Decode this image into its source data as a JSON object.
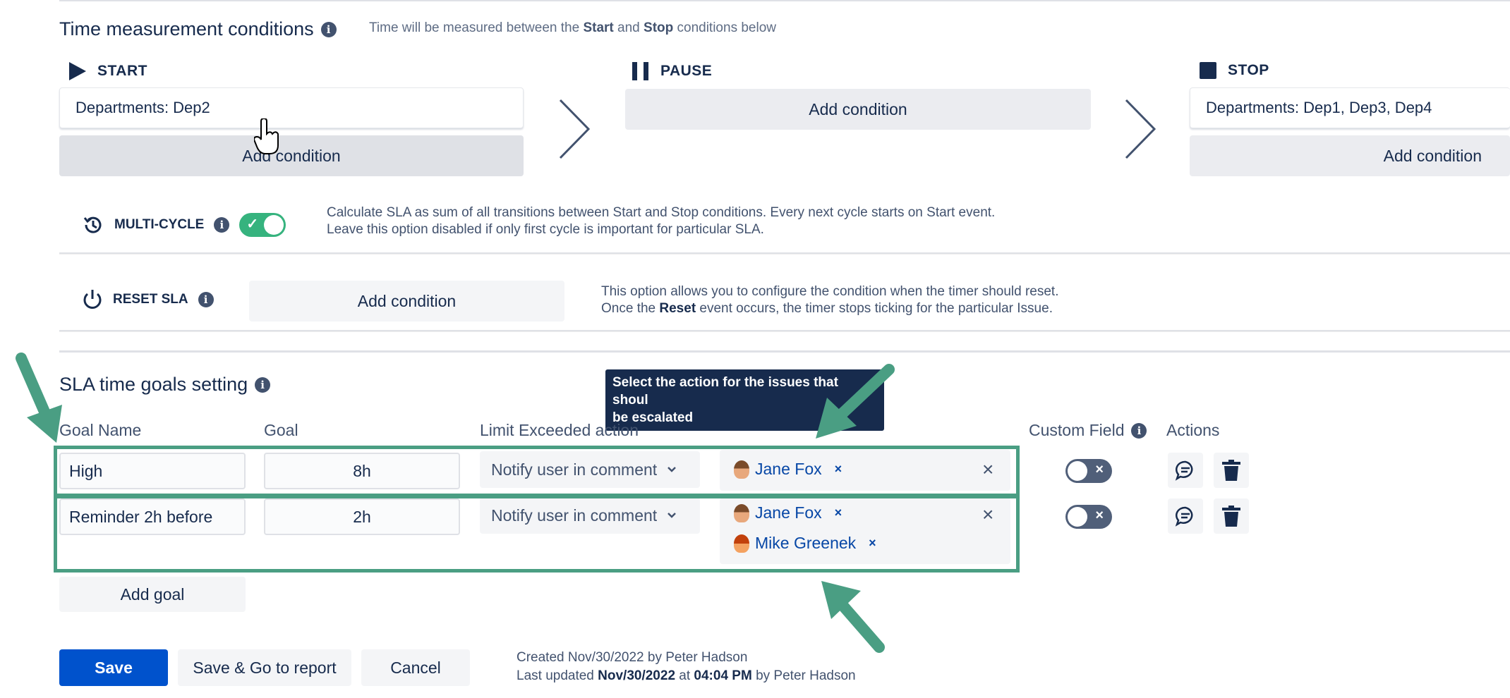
{
  "time_measurement": {
    "title": "Time measurement conditions",
    "hint_parts": [
      "Time will be measured between the ",
      "Start",
      " and ",
      "Stop",
      " conditions below"
    ],
    "start": {
      "label": "START",
      "condition": "Departments: Dep2",
      "add_label": "Add condition"
    },
    "pause": {
      "label": "PAUSE",
      "add_label": "Add condition"
    },
    "stop": {
      "label": "STOP",
      "condition": "Departments: Dep1, Dep3, Dep4",
      "add_label": "Add condition"
    }
  },
  "multi_cycle": {
    "label": "MULTI-CYCLE",
    "enabled": true,
    "desc_line1": "Calculate SLA as sum of all transitions between Start and Stop conditions. Every next cycle starts on Start event.",
    "desc_line2": "Leave this option disabled if only first cycle is important for particular SLA."
  },
  "reset_sla": {
    "label": "RESET SLA",
    "add_label": "Add condition",
    "desc_line1": "This option allows you to configure the condition when the timer should reset.",
    "desc_line2_parts": [
      "Once the ",
      "Reset",
      " event occurs, the timer stops ticking for the particular Issue."
    ]
  },
  "goals": {
    "title": "SLA time goals setting",
    "tooltip_line1": "Select the action for the issues that shoul",
    "tooltip_line2": "be escalated",
    "headers": {
      "goal_name": "Goal Name",
      "goal": "Goal",
      "action": "Limit Exceeded action",
      "custom_field": "Custom Field",
      "actions": "Actions"
    },
    "rows": [
      {
        "name": "High",
        "goal": "8h",
        "action": "Notify user in comment",
        "users": [
          "Jane Fox"
        ],
        "custom_field": false
      },
      {
        "name": "Reminder 2h before",
        "goal": "2h",
        "action": "Notify user in comment",
        "users": [
          "Jane Fox",
          "Mike Greenek"
        ],
        "custom_field": false
      }
    ],
    "add_goal_label": "Add goal"
  },
  "footer": {
    "save": "Save",
    "save_report": "Save & Go to report",
    "cancel": "Cancel",
    "created": "Created Nov/30/2022 by Peter Hadson",
    "updated_parts": [
      "Last updated ",
      "Nov/30/2022",
      " at ",
      "04:04 PM",
      " by Peter Hadson"
    ]
  },
  "colors": {
    "primary": "#0052cc",
    "toggle_on": "#36b37e",
    "highlight": "#4a9e83"
  }
}
